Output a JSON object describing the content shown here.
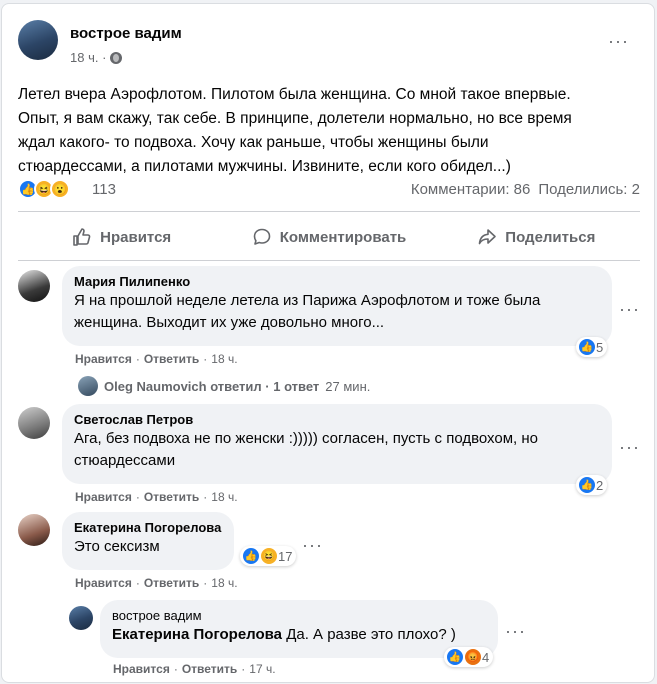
{
  "post": {
    "author": "вострое вадим",
    "time": "18 ч. ·",
    "text": "Летел вчера Аэрофлотом. Пилотом была женщина. Со мной такое впервые.\nОпыт, я вам скажу, так себе. В принципе, долетели нормально, но все время\nждал какого- то подвоха. Хочу как раньше, чтобы женщины были\nстюардессами, а пилотами мужчины. Извините, если кого обидел...)",
    "reactions_count": "113",
    "comments_count": "Комментарии: 86",
    "shares_count": "Поделились: 2",
    "like_label": "Нравится",
    "comment_label": "Комментировать",
    "share_label": "Поделиться"
  },
  "comments": [
    {
      "name": "Мария Пилипенко",
      "text": "Я на прошлой неделе летела из Парижа Аэрофлотом и тоже была\nженщина. Выходит их уже довольно много...",
      "like": "Нравится",
      "reply": "Ответить",
      "time": "18 ч.",
      "reactions": "5"
    },
    {
      "name": "Светослав Петров",
      "text": "Ага, без подвоха не по женски :))))) согласен, пусть с подвохом, но\nстюардессами",
      "like": "Нравится",
      "reply": "Ответить",
      "time": "18 ч.",
      "reactions": "2"
    },
    {
      "name": "Екатерина Погорелова",
      "text": "Это сексизм",
      "like": "Нравится",
      "reply": "Ответить",
      "time": "18 ч.",
      "reactions": "17"
    }
  ],
  "reply_summary": {
    "text": "Oleg Naumovich ответил · 1 ответ",
    "time": "27 мин."
  },
  "reply": {
    "name": "вострое вадим",
    "mention": "Екатерина Погорелова",
    "text": " Да. А разве это плохо? )",
    "like": "Нравится",
    "reply": "Ответить",
    "time": "17 ч.",
    "reactions": "4"
  },
  "colors": {
    "like_blue": "#1877f2",
    "haha_yellow": "#f7b125",
    "angry_orange": "#e9710f",
    "secondary_text": "#65676b",
    "bubble_bg": "#f0f2f5"
  }
}
